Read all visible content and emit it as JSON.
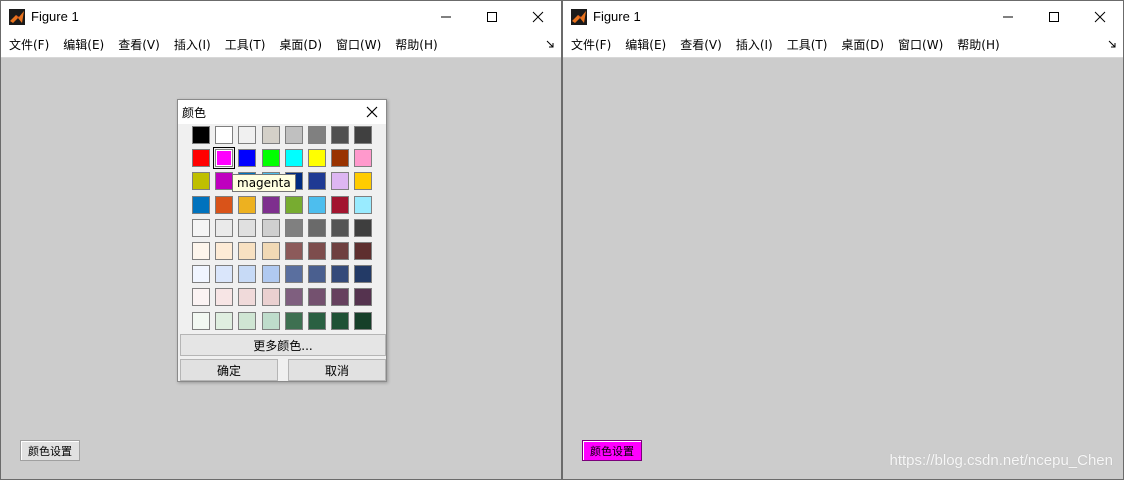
{
  "windows": [
    {
      "title": "Figure 1",
      "menu": [
        "文件(F)",
        "编辑(E)",
        "查看(V)",
        "插入(I)",
        "工具(T)",
        "桌面(D)",
        "窗口(W)",
        "帮助(H)"
      ],
      "button_label": "颜色设置",
      "button_color": "#e1e1e1"
    },
    {
      "title": "Figure 1",
      "menu": [
        "文件(F)",
        "编辑(E)",
        "查看(V)",
        "插入(I)",
        "工具(T)",
        "桌面(D)",
        "窗口(W)",
        "帮助(H)"
      ],
      "button_label": "颜色设置",
      "button_color": "#ff00ff"
    }
  ],
  "color_dialog": {
    "title": "颜色",
    "more_label": "更多颜色...",
    "ok_label": "确定",
    "cancel_label": "取消",
    "tooltip": "magenta",
    "selected": {
      "row": 1,
      "col": 1
    },
    "swatches": [
      [
        "#000000",
        "#ffffff",
        "#f0f0f0",
        "#d4d0c8",
        "#c0c0c0",
        "#808080",
        "#505050",
        "#404040"
      ],
      [
        "#ff0000",
        "#ff00ff",
        "#0000ff",
        "#00ff00",
        "#00ffff",
        "#ffff00",
        "#993300",
        "#ff99cc"
      ],
      [
        "#bfbf00",
        "#bf00bf",
        "#0072bd",
        "#4dbeee",
        "#002b80",
        "#1f3a93",
        "#ddb6f2",
        "#ffcc00"
      ],
      [
        "#0072bd",
        "#d95319",
        "#edb120",
        "#7e2f8e",
        "#77ac30",
        "#4dbeee",
        "#a2142f",
        "#99ebff"
      ],
      [
        "#f5f5f5",
        "#eaeaea",
        "#e0e0e0",
        "#cfcfcf",
        "#808080",
        "#6a6a6a",
        "#545454",
        "#3e3e3e"
      ],
      [
        "#fdf5ec",
        "#fdebd6",
        "#f8e1c2",
        "#f1d9b5",
        "#8c5a5a",
        "#7d4d4d",
        "#6e3f3f",
        "#5e2f2f"
      ],
      [
        "#f0f5ff",
        "#dae6fb",
        "#c7daf6",
        "#b0c9f0",
        "#5a6f9f",
        "#4a5f8f",
        "#344a7a",
        "#233a66"
      ],
      [
        "#fbf3f3",
        "#f7e5e5",
        "#f0dada",
        "#ead0d0",
        "#7f5f7f",
        "#74516f",
        "#66405e",
        "#55334f"
      ],
      [
        "#f2f8f2",
        "#dfeee0",
        "#cfe5d3",
        "#bedccb",
        "#3e7051",
        "#2a6042",
        "#1f5135",
        "#163f29"
      ]
    ]
  },
  "watermark": "https://blog.csdn.net/ncepu_Chen"
}
